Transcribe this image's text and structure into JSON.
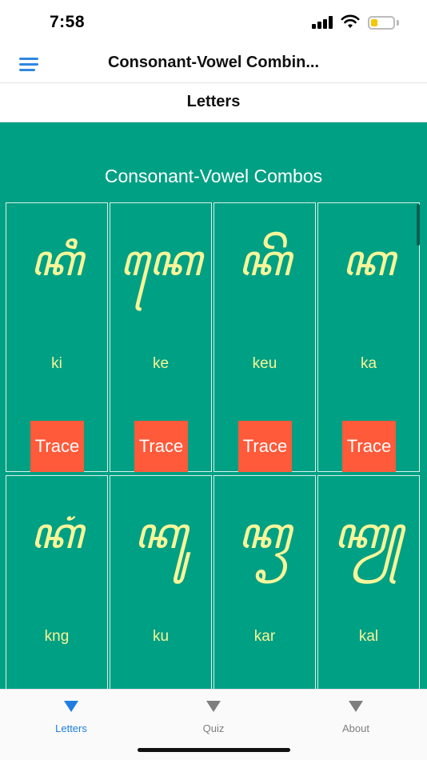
{
  "status_bar": {
    "time": "7:58",
    "battery_level": 0.3,
    "battery_color": "#f6c700"
  },
  "header": {
    "title": "Consonant-Vowel Combin...",
    "menu_icon": "hamburger-menu-icon"
  },
  "section": {
    "title": "Letters"
  },
  "content": {
    "background_color": "#00a084",
    "heading": "Consonant-Vowel Combos",
    "cards": [
      {
        "glyph": "ꦏꦶ",
        "roman": "ki",
        "button": "Trace"
      },
      {
        "glyph": "ꦏꦺ",
        "roman": "ke",
        "button": "Trace"
      },
      {
        "glyph": "ꦏꦼ",
        "roman": "keu",
        "button": "Trace"
      },
      {
        "glyph": "ꦏ",
        "roman": "ka",
        "button": "Trace"
      },
      {
        "glyph": "ꦏꦁ",
        "roman": "kng",
        "button": ""
      },
      {
        "glyph": "ꦏꦸ",
        "roman": "ku",
        "button": ""
      },
      {
        "glyph": "ꦏꦽ",
        "roman": "kar",
        "button": ""
      },
      {
        "glyph": "ꦏꦾ",
        "roman": "kal",
        "button": ""
      }
    ]
  },
  "tabs": [
    {
      "label": "Letters",
      "icon": "triangle-down-icon",
      "active": true
    },
    {
      "label": "Quiz",
      "icon": "triangle-down-icon",
      "active": false
    },
    {
      "label": "About",
      "icon": "triangle-down-icon",
      "active": false
    }
  ],
  "colors": {
    "accent": "#1f7de0",
    "trace_button": "#ff5a3a",
    "glyph": "#f7f59a"
  }
}
